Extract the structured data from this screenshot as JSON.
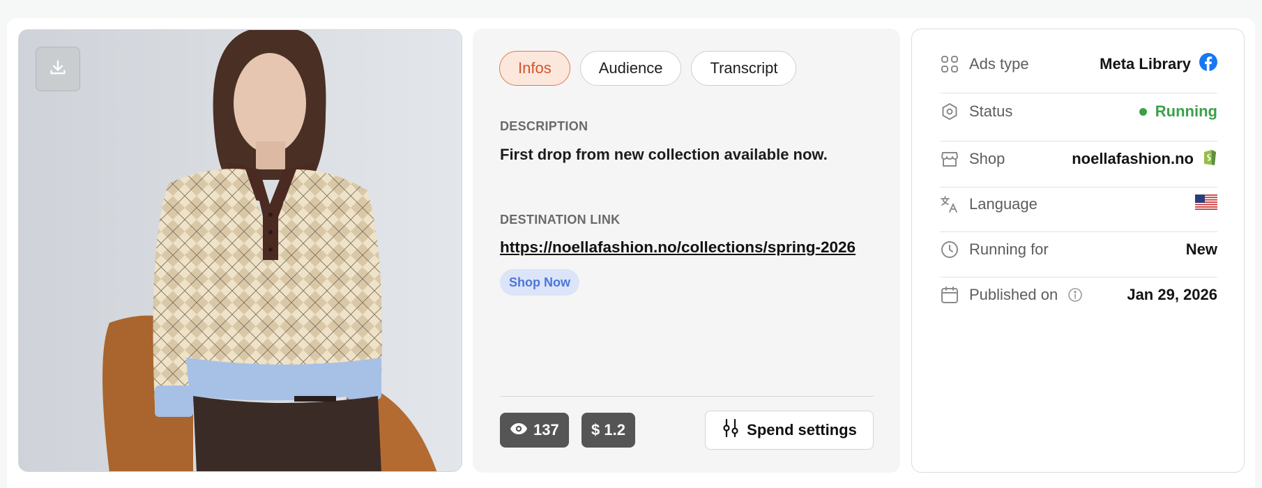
{
  "media": {
    "download_icon": "download-icon"
  },
  "tabs": [
    {
      "label": "Infos",
      "active": true
    },
    {
      "label": "Audience",
      "active": false
    },
    {
      "label": "Transcript",
      "active": false
    }
  ],
  "info": {
    "description_label": "DESCRIPTION",
    "description": "First drop from new collection available now.",
    "destination_label": "DESTINATION LINK",
    "destination_url": "https://noellafashion.no/collections/spring-2026",
    "cta": "Shop Now"
  },
  "stats": {
    "views_icon": "eye-icon",
    "views": "137",
    "spend": "$ 1.2",
    "spend_settings_label": "Spend settings",
    "spend_settings_icon": "sliders-icon"
  },
  "meta": [
    {
      "icon": "grid-icon",
      "label": "Ads type",
      "value": "Meta Library",
      "badge": "facebook-icon"
    },
    {
      "icon": "status-icon",
      "label": "Status",
      "value": "Running",
      "badge": "status-dot"
    },
    {
      "icon": "shop-icon",
      "label": "Shop",
      "value": "noellafashion.no",
      "badge": "shopify-icon"
    },
    {
      "icon": "translate-icon",
      "label": "Language",
      "value": "",
      "badge": "us-flag-icon"
    },
    {
      "icon": "clock-icon",
      "label": "Running for",
      "value": "New",
      "badge": ""
    },
    {
      "icon": "calendar-icon",
      "label": "Published on",
      "value": "Jan 29, 2026",
      "badge": "info-icon"
    }
  ],
  "colors": {
    "accent": "#d4532c",
    "accent_bg": "#fbe7dc",
    "running": "#3aa14a",
    "cta_bg": "#dbe4f8",
    "cta_text": "#4e76d8",
    "facebook": "#1877f2",
    "shopify": "#95bf47"
  }
}
